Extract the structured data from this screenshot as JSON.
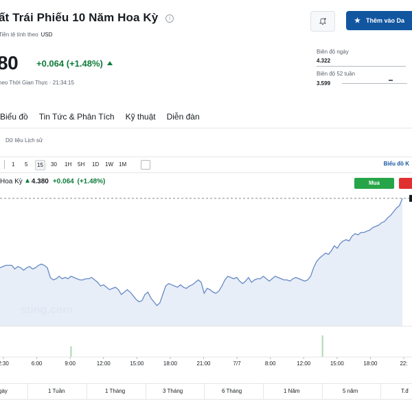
{
  "header": {
    "title": "ất Trái Phiếu 10 Năm Hoa Kỳ",
    "currency_label": "Tiền tệ tính theo",
    "currency_value": "USD",
    "price": "80",
    "change": "+0.064",
    "change_pct": "(+1.48%)",
    "realtime": "heo Thời Gian Thực · 21:34:15",
    "info_glyph": "i",
    "watch_button": "Thêm vào Da",
    "accent_color": "#1256a0",
    "positive_color": "#0e7c3a"
  },
  "ranges": {
    "day_label": "Biên độ ngày",
    "day_value": "4.322",
    "week52_label": "Biên độ 52 tuần",
    "week52_value": "3.599"
  },
  "tabs": [
    "Biểu đồ",
    "Tin Tức & Phân Tích",
    "Kỹ thuật",
    "Diễn đàn"
  ],
  "historical_link": "Dữ liệu Lịch sử",
  "toolbar": {
    "timeframes": [
      "1",
      "5",
      "15",
      "30",
      "1H",
      "5H",
      "1D",
      "1W",
      "1M"
    ],
    "active_timeframe": "15",
    "chart_settings": "Biểu đồ K"
  },
  "chart_header": {
    "name": "Hoa Kỳ",
    "price": "4.380",
    "change": "+0.064",
    "change_pct": "(+1.48%)",
    "buy_button": "Mua",
    "watermark": "sting.com"
  },
  "chart_data": {
    "type": "area",
    "x_ticks": [
      "2:30",
      "6:00",
      "9:00",
      "12:00",
      "15:00",
      "18:00",
      "21:00",
      "7/7",
      "8:00",
      "12:00",
      "15:00",
      "18:00",
      "22:"
    ],
    "values": [
      4.26,
      4.261,
      4.262,
      4.262,
      4.262,
      4.259,
      4.261,
      4.26,
      4.258,
      4.26,
      4.261,
      4.259,
      4.26,
      4.262,
      4.263,
      4.262,
      4.26,
      4.252,
      4.25,
      4.251,
      4.253,
      4.251,
      4.252,
      4.251,
      4.253,
      4.252,
      4.251,
      4.25,
      4.25,
      4.251,
      4.251,
      4.252,
      4.25,
      4.248,
      4.245,
      4.246,
      4.244,
      4.242,
      4.243,
      4.244,
      4.242,
      4.238,
      4.24,
      4.242,
      4.24,
      4.237,
      4.234,
      4.232,
      4.233,
      4.238,
      4.24,
      4.235,
      4.232,
      4.229,
      4.231,
      4.238,
      4.245,
      4.247,
      4.246,
      4.245,
      4.244,
      4.246,
      4.244,
      4.243,
      4.245,
      4.246,
      4.248,
      4.25,
      4.248,
      4.239,
      4.243,
      4.242,
      4.24,
      4.239,
      4.241,
      4.245,
      4.25,
      4.253,
      4.252,
      4.251,
      4.252,
      4.249,
      4.247,
      4.249,
      4.252,
      4.248,
      4.25,
      4.251,
      4.251,
      4.253,
      4.251,
      4.249,
      4.251,
      4.253,
      4.252,
      4.251,
      4.25,
      4.25,
      4.249,
      4.251,
      4.252,
      4.251,
      4.25,
      4.249,
      4.25,
      4.253,
      4.26,
      4.265,
      4.268,
      4.27,
      4.272,
      4.271,
      4.274,
      4.278,
      4.276,
      4.28,
      4.282,
      4.283,
      4.282,
      4.286,
      4.288,
      4.287,
      4.289,
      4.289,
      4.29,
      4.291,
      4.293,
      4.294,
      4.295,
      4.297,
      4.298,
      4.301,
      4.303,
      4.306,
      4.309,
      4.311,
      4.317
    ],
    "volume_spikes": [
      {
        "index": 24,
        "value": 0.35
      },
      {
        "index": 109,
        "value": 0.7
      }
    ],
    "line_color": "#6688c4",
    "fill_color": "#e3ebf7",
    "ylim": [
      4.212,
      4.322
    ]
  },
  "periods": [
    "gày",
    "1 Tuần",
    "1 Tháng",
    "3 Tháng",
    "6 Tháng",
    "1 Năm",
    "5 năm",
    "T.đ"
  ]
}
